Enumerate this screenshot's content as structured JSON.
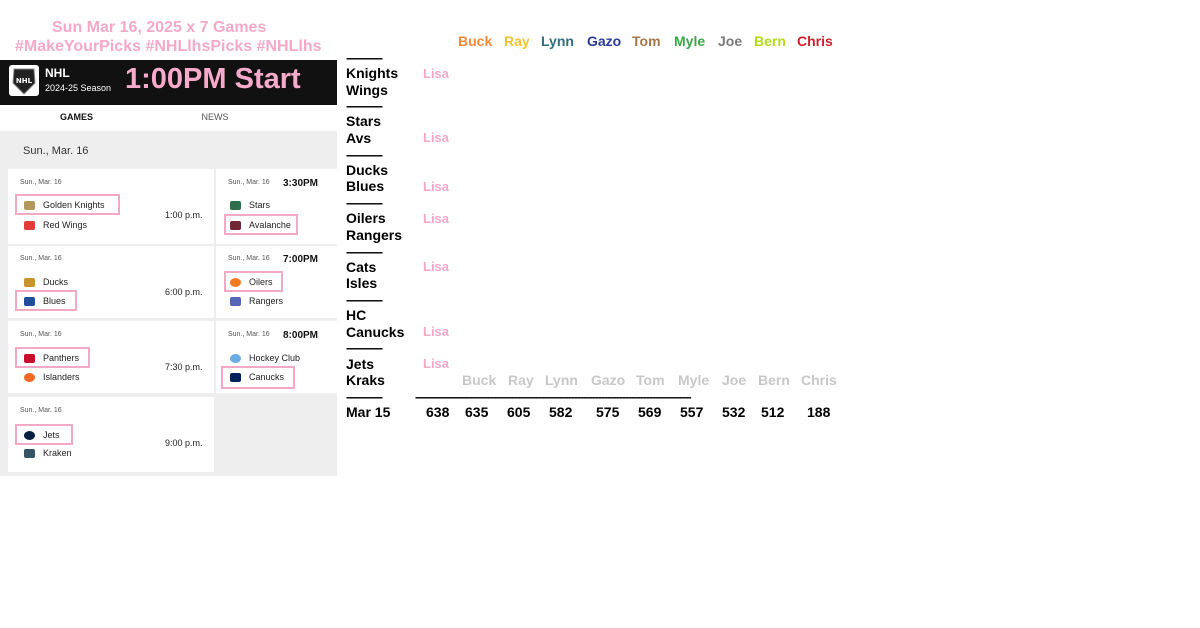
{
  "header": {
    "line1": "Sun Mar 16, 2025    x 7 Games",
    "line2": "#MakeYourPicks #NHLlhsPicks #NHLlhs"
  },
  "nhl": {
    "name": "NHL",
    "season": "2024-25 Season",
    "start": "1:00PM Start",
    "tabs": [
      "GAMES",
      "NEWS"
    ],
    "date_heading": "Sun., Mar. 16"
  },
  "games": [
    {
      "date": "Sun., Mar. 16",
      "team1": "Golden Knights",
      "team2": "Red Wings",
      "time": "1:00 p.m.",
      "icon1": "golden-knights-logo-icon",
      "icon2": "red-wings-logo-icon"
    },
    {
      "date": "Sun., Mar. 16",
      "team1": "Stars",
      "team2": "Avalanche",
      "time": "3:30PM",
      "icon1": "stars-logo-icon",
      "icon2": "avalanche-logo-icon"
    },
    {
      "date": "Sun., Mar. 16",
      "team1": "Ducks",
      "team2": "Blues",
      "time": "6:00 p.m.",
      "icon1": "ducks-logo-icon",
      "icon2": "blues-logo-icon"
    },
    {
      "date": "Sun., Mar. 16",
      "team1": "Oilers",
      "team2": "Rangers",
      "time": "7:00PM",
      "icon1": "oilers-logo-icon",
      "icon2": "rangers-logo-icon"
    },
    {
      "date": "Sun., Mar. 16",
      "team1": "Panthers",
      "team2": "Islanders",
      "time": "7:30 p.m.",
      "icon1": "panthers-logo-icon",
      "icon2": "islanders-logo-icon"
    },
    {
      "date": "Sun., Mar. 16",
      "team1": "Hockey Club",
      "team2": "Canucks",
      "time": "8:00PM",
      "icon1": "hockey-club-logo-icon",
      "icon2": "canucks-logo-icon"
    },
    {
      "date": "Sun., Mar. 16",
      "team1": "Jets",
      "team2": "Kraken",
      "time": "9:00 p.m.",
      "icon1": "jets-logo-icon",
      "icon2": "kraken-logo-icon"
    }
  ],
  "pickers": [
    {
      "name": "Buck",
      "color": "#f08a3a"
    },
    {
      "name": "Ray",
      "color": "#f6c230"
    },
    {
      "name": "Lynn",
      "color": "#2f6f7f"
    },
    {
      "name": "Gazo",
      "color": "#2b3a9a"
    },
    {
      "name": "Tom",
      "color": "#a8754a"
    },
    {
      "name": "Myle",
      "color": "#3aa84a"
    },
    {
      "name": "Joe",
      "color": "#7a7a7a"
    },
    {
      "name": "Bern",
      "color": "#b5d91d"
    },
    {
      "name": "Chris",
      "color": "#d01f2a"
    }
  ],
  "matchups": [
    {
      "sep": "------------",
      "l1": "Knights",
      "l2": "Wings",
      "pick": "Lisa"
    },
    {
      "sep": "------------",
      "l1": "Stars",
      "l2": "Avs",
      "pick": "Lisa"
    },
    {
      "sep": "------------",
      "l1": "Ducks",
      "l2": "Blues",
      "pick": "Lisa"
    },
    {
      "sep": "------------",
      "l1": "Oilers",
      "l2": "Rangers",
      "pick": "Lisa"
    },
    {
      "sep": "------------",
      "l1": "Cats",
      "l2": "Isles",
      "pick": "Lisa"
    },
    {
      "sep": "------------",
      "l1": "HC",
      "l2": "Canucks",
      "pick": "Lisa"
    },
    {
      "sep": "------------",
      "l1": "Jets",
      "l2": "Kraks",
      "pick": "Lisa"
    }
  ],
  "standings": {
    "sep_left": "------------",
    "sep_right": "--------------------------------------------------------------------------------------------",
    "date": "Mar 15",
    "names": [
      "Buck",
      "Ray",
      "Lynn",
      "Gazo",
      "Tom",
      "Myle",
      "Joe",
      "Bern",
      "Chris"
    ],
    "scores": [
      "638",
      "635",
      "605",
      "582",
      "575",
      "569",
      "557",
      "532",
      "512",
      "188"
    ]
  }
}
